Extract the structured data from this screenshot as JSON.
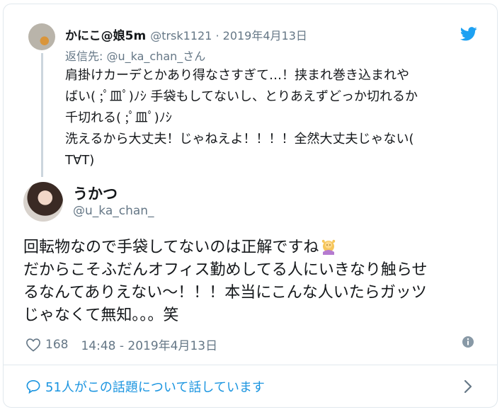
{
  "parent_tweet": {
    "name": "かにこ@娘5m",
    "handle": "@trsk1121",
    "date": "2019年4月13日",
    "reply_to": "返信先: @u_ka_chan_さん",
    "text_lines": [
      "肩掛けカーデとかあり得なさすぎて…！挟まれ巻き込まれや",
      "ばい( ;ﾟ皿ﾟ)ﾉｼ 手袋もしてないし、とりあえずどっか切れるか",
      "千切れる( ;ﾟ皿ﾟ)ﾉｼ",
      "洗えるから大丈夫！じゃねえよ！！！！全然大丈夫じゃない(",
      "T∀T)"
    ],
    "meta_sep": " · "
  },
  "main_tweet": {
    "name": "うかつ",
    "handle": "@u_ka_chan_",
    "text_lines": [
      "回転物なので手袋してないのは正解ですね",
      "だからこそふだんオフィス勤めしてる人にいきなり触らせ",
      "るなんてありえない〜！！！本当にこんな人いたらガッツ",
      "じゃなくて無知。。。笑"
    ],
    "emoji": "person-gesturing-ok-emoji"
  },
  "footer": {
    "likes": "168",
    "timestamp": "14:48 - 2019年4月13日",
    "conversation": "51人がこの話題について話しています"
  },
  "colors": {
    "link": "#1b95e0",
    "muted": "#657786",
    "text": "#14171a",
    "border": "#e1e8ed"
  },
  "icons": [
    "twitter-bird-icon",
    "heart-icon",
    "info-icon",
    "speech-bubble-icon",
    "chevron-right-icon"
  ]
}
